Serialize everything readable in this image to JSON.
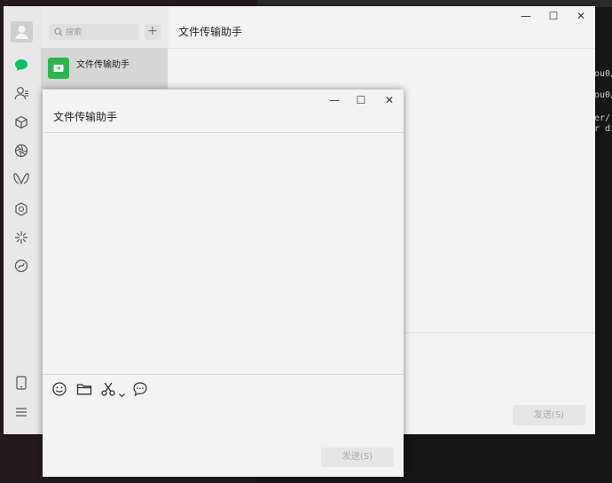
{
  "terminal": {
    "lines": [
      "ou0/",
      "ou0/",
      "er/.",
      "r di"
    ]
  },
  "main_window": {
    "search_placeholder": "搜索",
    "add_label": "+",
    "chat_list": [
      {
        "name": "文件传输助手"
      }
    ],
    "title": "文件传输助手",
    "send_label": "发送(S)",
    "controls": {
      "minimize": "—",
      "maximize": "☐",
      "close": "✕"
    }
  },
  "popup_window": {
    "title": "文件传输助手",
    "send_label": "发送(S)",
    "controls": {
      "minimize": "—",
      "maximize": "☐",
      "close": "✕"
    },
    "toolbar": [
      "emoji-icon",
      "folder-icon",
      "scissors-icon",
      "chevron-down-icon",
      "chat-history-icon"
    ]
  },
  "sidebar": {
    "icons": [
      "avatar",
      "chat-icon",
      "contacts-icon",
      "favorites-cube-icon",
      "moments-aperture-icon",
      "channels-icon",
      "search-hex-icon",
      "mini-programs-icon",
      "link-icon",
      "phone-icon",
      "menu-icon"
    ]
  },
  "colors": {
    "accent": "#07c160",
    "file_helper": "#2db650"
  }
}
